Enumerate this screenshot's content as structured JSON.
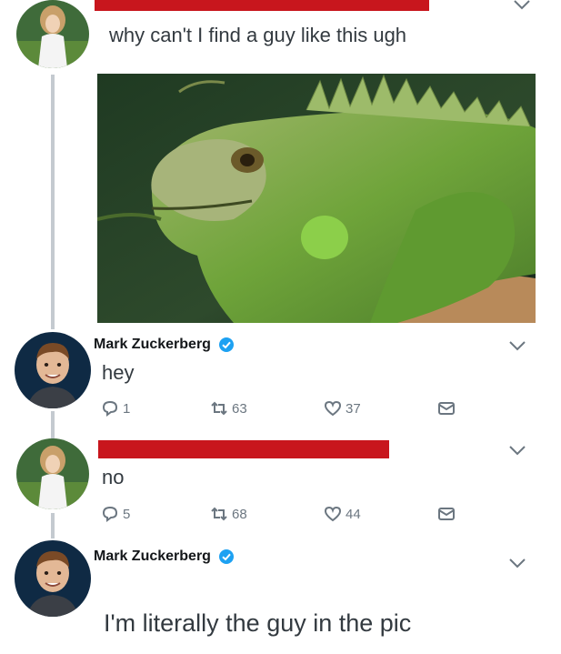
{
  "tweets": [
    {
      "author": "",
      "text": "why can't I find a guy like this ugh",
      "has_photo": true
    },
    {
      "author": "Mark Zuckerberg",
      "verified": true,
      "text": "hey",
      "actions": {
        "replies": "1",
        "retweets": "63",
        "likes": "37"
      }
    },
    {
      "author": "",
      "text": "no",
      "actions": {
        "replies": "5",
        "retweets": "68",
        "likes": "44"
      }
    },
    {
      "author": "Mark Zuckerberg",
      "verified": true,
      "text": "I'm literally the guy in the pic"
    }
  ],
  "colors": {
    "redaction": "#c8161d",
    "verified": "#1da1f2",
    "thread_line": "#c4cad0",
    "meta_text": "#6b7680"
  },
  "icons": [
    "reply-icon",
    "retweet-icon",
    "like-icon",
    "direct-message-icon",
    "chevron-down-icon",
    "verified-badge-icon"
  ]
}
